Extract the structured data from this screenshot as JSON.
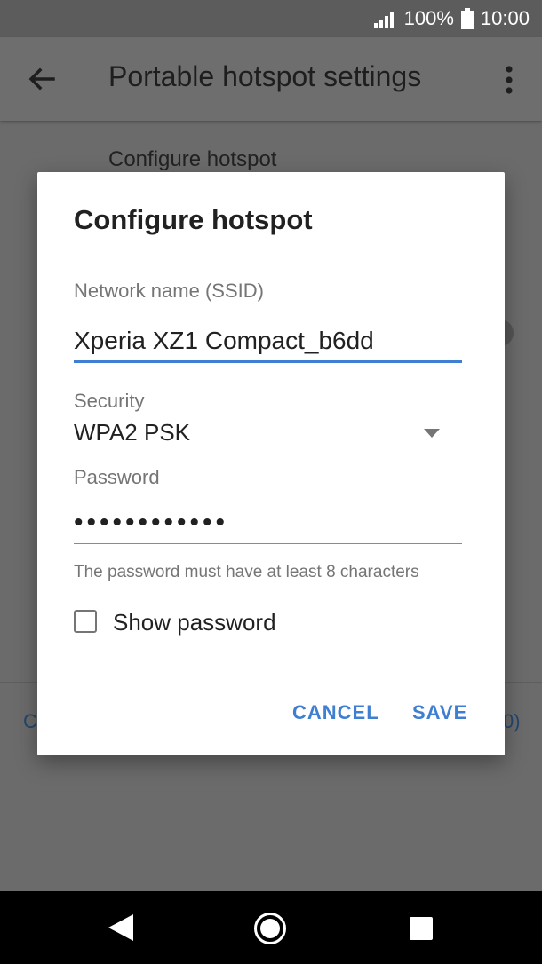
{
  "status_bar": {
    "battery": "100%",
    "time": "10:00",
    "icons": [
      "signal-icon",
      "battery-icon"
    ]
  },
  "app_bar": {
    "title": "Portable hotspot settings",
    "back_icon": "arrow-left-icon",
    "menu_icon": "more-vert-icon"
  },
  "background": {
    "configure_label": "Configure hotspot",
    "left_text": "C",
    "right_text": "0)"
  },
  "dialog": {
    "title": "Configure hotspot",
    "ssid_label": "Network name (SSID)",
    "ssid_value": "Xperia XZ1 Compact_b6dd",
    "security_label": "Security",
    "security_value": "WPA2 PSK",
    "password_label": "Password",
    "password_value": "••••••••••••",
    "password_hint": "The password must have at least 8 characters",
    "show_password_label": "Show password",
    "show_password_checked": false,
    "cancel_label": "CANCEL",
    "save_label": "SAVE"
  },
  "colors": {
    "accent": "#3f7fd1",
    "scrim": "#6b6b6b",
    "nav_bar": "#000000"
  },
  "nav_bar": {
    "icons": [
      "back-triangle-icon",
      "home-circle-icon",
      "recents-square-icon"
    ]
  }
}
